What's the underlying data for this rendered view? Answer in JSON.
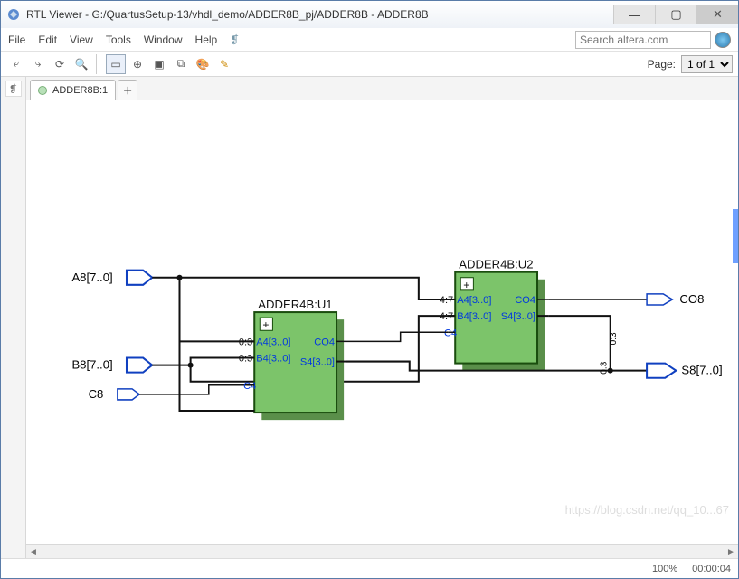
{
  "window": {
    "title": "RTL Viewer - G:/QuartusSetup-13/vhdl_demo/ADDER8B_pj/ADDER8B - ADDER8B"
  },
  "menu": {
    "items": [
      "File",
      "Edit",
      "View",
      "Tools",
      "Window",
      "Help"
    ]
  },
  "search": {
    "placeholder": "Search altera.com"
  },
  "page": {
    "label": "Page:",
    "value": "1 of 1"
  },
  "tab": {
    "label": "ADDER8B:1"
  },
  "status": {
    "zoom": "100%",
    "time": "00:00:04"
  },
  "schematic": {
    "inputs": {
      "a": "A8[7..0]",
      "b": "B8[7..0]",
      "c": "C8"
    },
    "outputs": {
      "co": "CO8",
      "s": "S8[7..0]"
    },
    "u1": {
      "title": "ADDER4B:U1",
      "pins": {
        "a": "A4[3..0]",
        "b": "B4[3..0]",
        "c": "C4",
        "co": "CO4",
        "s": "S4[3..0]"
      },
      "slice_a": "0:3",
      "slice_b": "0:3"
    },
    "u2": {
      "title": "ADDER4B:U2",
      "pins": {
        "a": "A4[3..0]",
        "b": "B4[3..0]",
        "c": "C4",
        "co": "CO4",
        "s": "S4[3..0]"
      },
      "slice_a": "4:7",
      "slice_b": "4:7"
    },
    "bus_hi": "0:3",
    "bus_lo": "0:3"
  },
  "watermark": "https://blog.csdn.net/qq_10...67"
}
